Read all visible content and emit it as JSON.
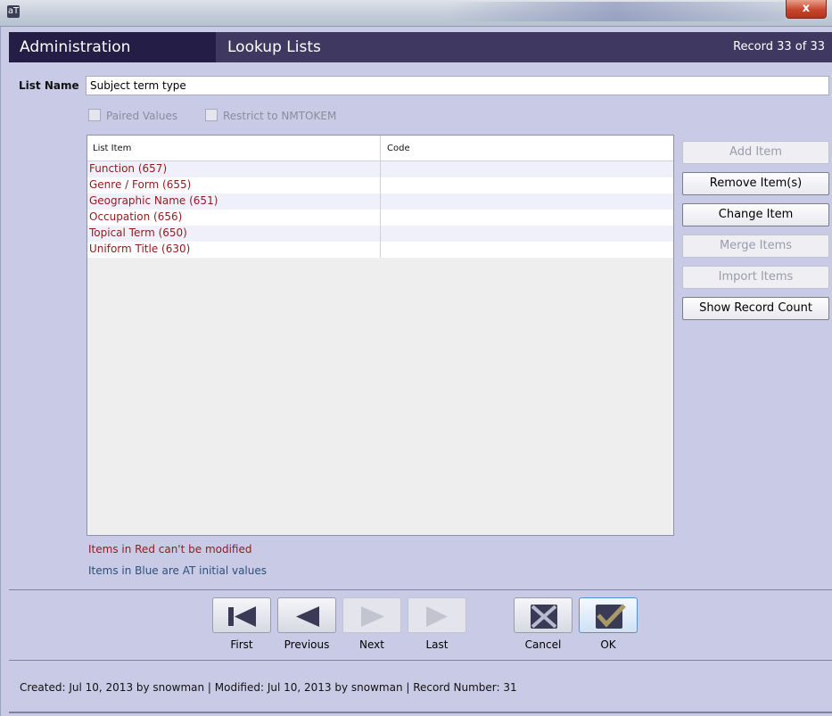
{
  "window": {
    "title": "",
    "close_label": "x",
    "app_icon": "aT"
  },
  "header": {
    "module": "Administration",
    "section": "Lookup Lists",
    "record_info": "Record 33 of 33"
  },
  "form": {
    "list_name_label": "List Name",
    "list_name_value": "Subject term type",
    "paired_values_label": "Paired Values",
    "restrict_label": "Restrict to NMTOKEM"
  },
  "table": {
    "columns": [
      "List Item",
      "Code"
    ],
    "rows": [
      {
        "item": "Function (657)",
        "code": ""
      },
      {
        "item": "Genre / Form (655)",
        "code": ""
      },
      {
        "item": "Geographic Name (651)",
        "code": ""
      },
      {
        "item": "Occupation (656)",
        "code": ""
      },
      {
        "item": "Topical Term (650)",
        "code": ""
      },
      {
        "item": "Uniform Title (630)",
        "code": ""
      }
    ]
  },
  "side_buttons": {
    "add": "Add Item",
    "remove": "Remove Item(s)",
    "change": "Change Item",
    "merge": "Merge Items",
    "import": "Import Items",
    "show_count": "Show Record Count"
  },
  "notes": {
    "red": "Items in Red can't be modified",
    "blue": "Items in Blue are AT initial values"
  },
  "nav": {
    "first": "First",
    "previous": "Previous",
    "next": "Next",
    "last": "Last",
    "cancel": "Cancel",
    "ok": "OK"
  },
  "footer": {
    "text": "Created: Jul 10, 2013 by snowman | Modified: Jul 10, 2013 by snowman | Record Number: 31"
  },
  "colors": {
    "header_bg": "#3f3962",
    "header_tab_bg": "#241d45",
    "page_bg": "#c9cbe6",
    "readonly_item": "#8f1b1b",
    "initial_item": "#2d4f78"
  }
}
